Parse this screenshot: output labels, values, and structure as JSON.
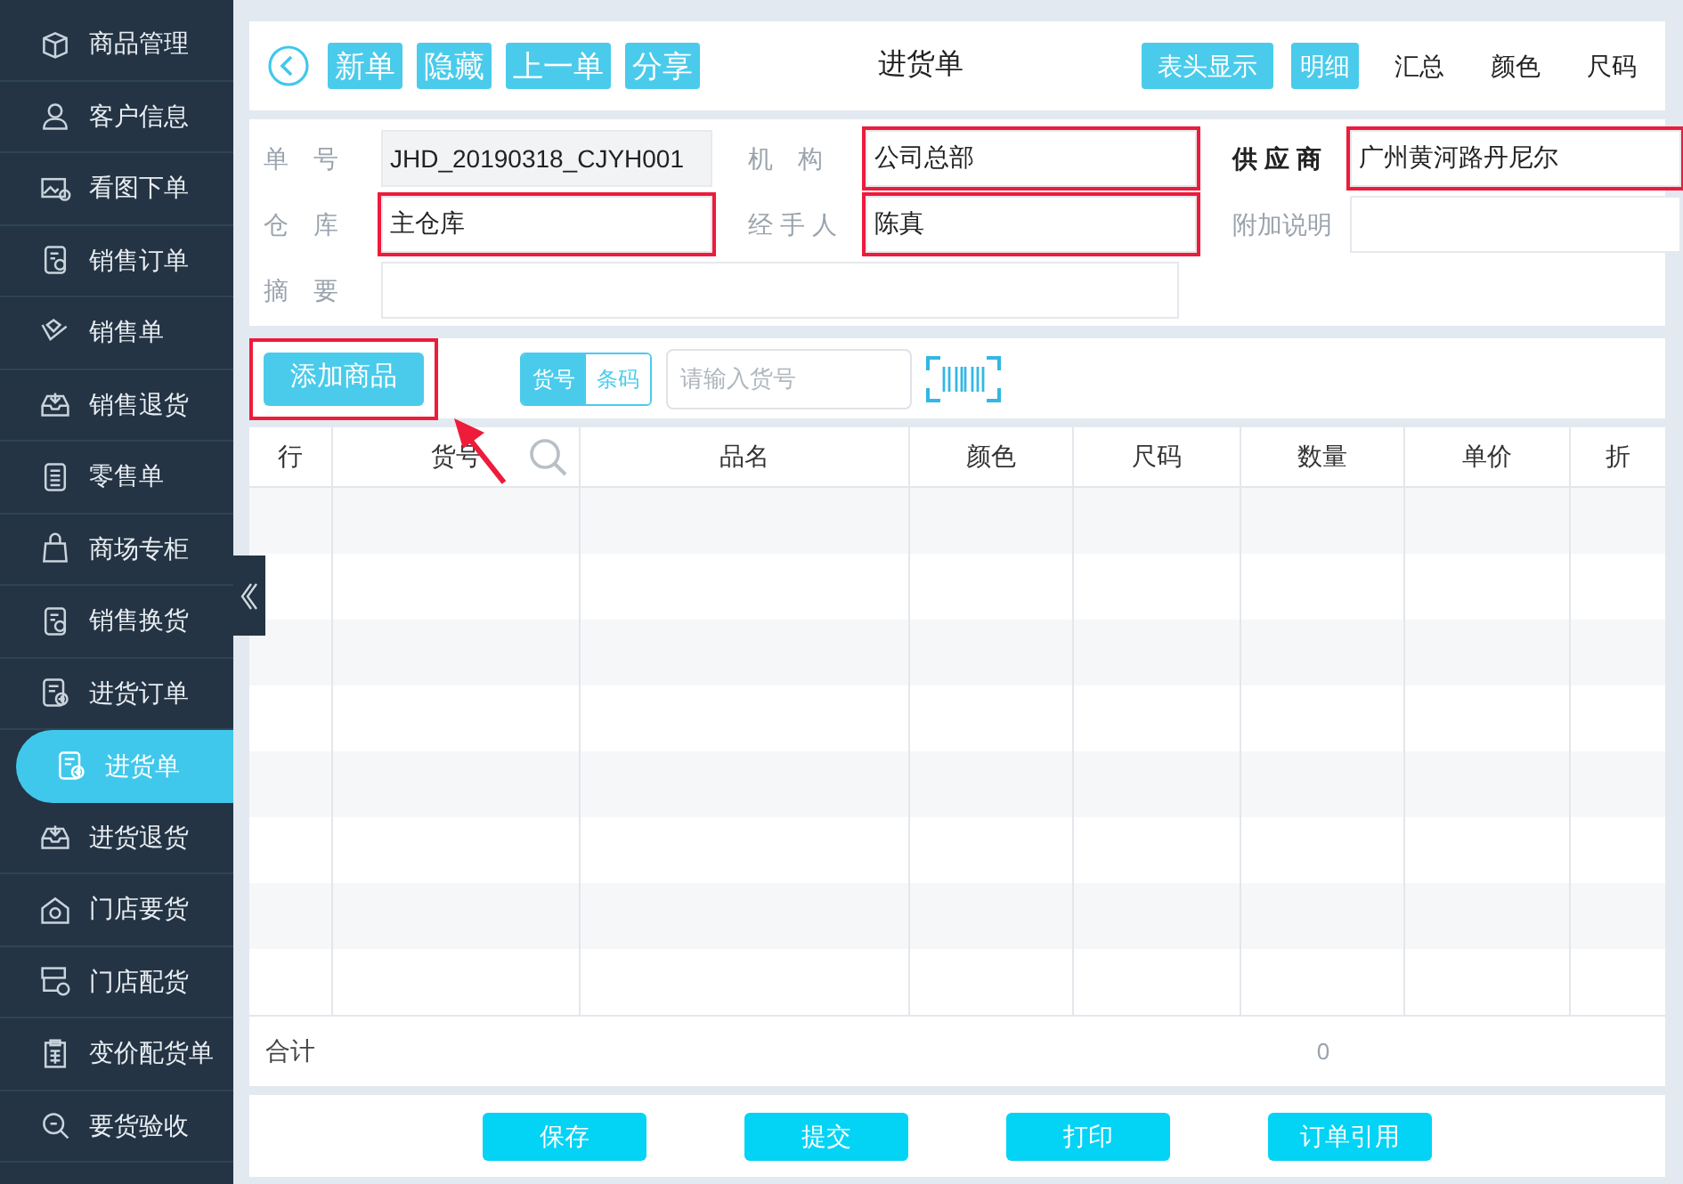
{
  "sidebar": {
    "items": [
      {
        "label": "商品管理",
        "selected": false
      },
      {
        "label": "客户信息",
        "selected": false
      },
      {
        "label": "看图下单",
        "selected": false
      },
      {
        "label": "销售订单",
        "selected": false
      },
      {
        "label": "销售单",
        "selected": false
      },
      {
        "label": "销售退货",
        "selected": false
      },
      {
        "label": "零售单",
        "selected": false
      },
      {
        "label": "商场专柜",
        "selected": false
      },
      {
        "label": "销售换货",
        "selected": false
      },
      {
        "label": "进货订单",
        "selected": false
      },
      {
        "label": "进货单",
        "selected": true
      },
      {
        "label": "进货退货",
        "selected": false
      },
      {
        "label": "门店要货",
        "selected": false
      },
      {
        "label": "门店配货",
        "selected": false
      },
      {
        "label": "变价配货单",
        "selected": false
      },
      {
        "label": "要货验收",
        "selected": false
      }
    ]
  },
  "toolbar": {
    "left_buttons": [
      "新单",
      "隐藏",
      "上一单",
      "分享"
    ],
    "title": "进货单",
    "view_tabs": [
      {
        "label": "表头显示",
        "kind": "button",
        "selected": true
      },
      {
        "label": "明细",
        "kind": "tab",
        "selected": true
      },
      {
        "label": "汇总",
        "kind": "tab",
        "selected": false
      },
      {
        "label": "颜色",
        "kind": "tab",
        "selected": false
      },
      {
        "label": "尺码",
        "kind": "tab",
        "selected": false
      }
    ]
  },
  "form": {
    "rows": [
      [
        {
          "label": "单　号",
          "value": "JHD_20190318_CJYH001",
          "readonly": true,
          "highlighted": false,
          "bold_label": false
        },
        {
          "label": "机　构",
          "value": "公司总部",
          "readonly": false,
          "highlighted": true,
          "bold_label": false
        },
        {
          "label": "供 应 商",
          "value": "广州黄河路丹尼尔",
          "readonly": false,
          "highlighted": true,
          "bold_label": true
        }
      ],
      [
        {
          "label": "仓　库",
          "value": "主仓库",
          "readonly": false,
          "highlighted": true,
          "bold_label": false
        },
        {
          "label": "经 手 人",
          "value": "陈真",
          "readonly": false,
          "highlighted": true,
          "bold_label": false
        },
        {
          "label": "附加说明",
          "readonly": false,
          "highlighted": false,
          "bold_label": false
        }
      ],
      [
        {
          "label": "摘　要",
          "readonly": false,
          "highlighted": false,
          "bold_label": false
        }
      ]
    ]
  },
  "add_bar": {
    "add_button": {
      "label": "添加商品",
      "highlighted": true
    },
    "mode_toggle": [
      {
        "label": "货号",
        "selected": true
      },
      {
        "label": "条码",
        "selected": false
      }
    ],
    "search": {
      "placeholder": "请输入货号"
    }
  },
  "table": {
    "columns": [
      "行",
      "货号",
      "品名",
      "颜色",
      "尺码",
      "数量",
      "单价",
      "折"
    ],
    "total_label": "合计",
    "total_quantity": "0"
  },
  "footer_buttons": [
    "保存",
    "提交",
    "打印",
    "订单引用"
  ]
}
